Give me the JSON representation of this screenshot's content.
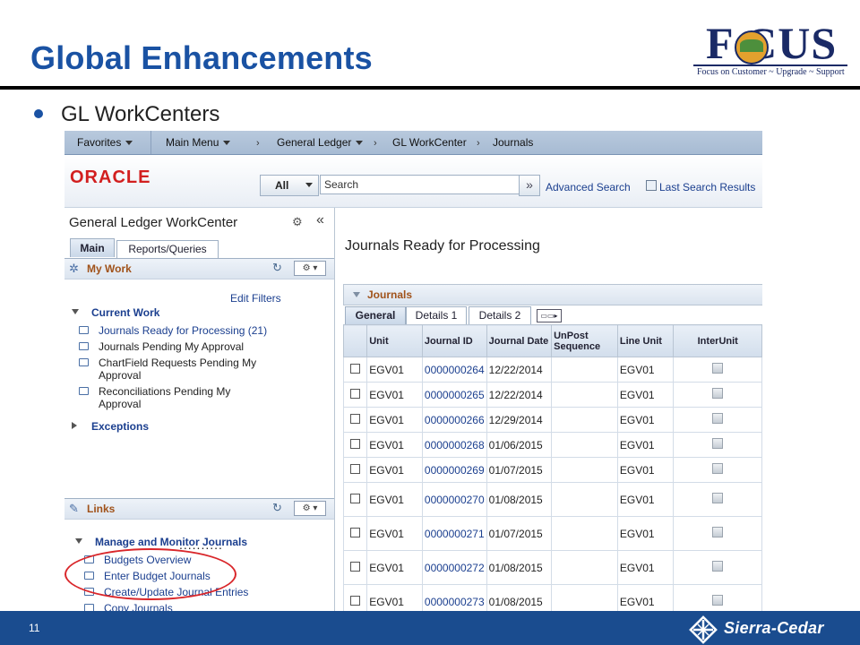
{
  "slide": {
    "title": "Global Enhancements",
    "bullet": "GL WorkCenters",
    "page_number": "11",
    "logo": {
      "word": "F  CUS",
      "tagline": "Focus on Customer ~ Upgrade ~ Support"
    },
    "footer_brand": "Sierra-Cedar",
    "colors": {
      "title": "#1a52a3",
      "footer": "#1a4c8f",
      "highlight_oval": "#d9262a"
    }
  },
  "app": {
    "navbar": {
      "favorites": "Favorites",
      "main_menu": "Main Menu",
      "crumbs": [
        "General Ledger",
        "GL WorkCenter",
        "Journals"
      ]
    },
    "header": {
      "brand": "ORACLE",
      "search_scope": "All",
      "search_placeholder": "Search",
      "advanced_search": "Advanced Search",
      "last_search_results": "Last Search Results"
    },
    "left_pane": {
      "title": "General Ledger WorkCenter",
      "tabs": [
        "Main",
        "Reports/Queries"
      ],
      "my_work": {
        "label": "My Work",
        "edit_filters": "Edit Filters",
        "current_work": "Current Work",
        "items": [
          "Journals Ready for Processing (21)",
          "Journals Pending My Approval",
          "ChartField Requests Pending My Approval",
          "Reconciliations Pending My Approval"
        ],
        "exceptions": "Exceptions",
        "more": ".........."
      },
      "links": {
        "label": "Links",
        "section": "Manage and Monitor Journals",
        "items": [
          "Budgets Overview",
          "Enter Budget Journals",
          "Create/Update Journal Entries",
          "Copy Journals"
        ]
      }
    },
    "main": {
      "page_title": "Journals Ready for Processing",
      "grid_title": "Journals",
      "tabs": [
        "General",
        "Details 1",
        "Details 2"
      ],
      "columns": [
        "Unit",
        "Journal ID",
        "Journal Date",
        "UnPost Sequence",
        "Line Unit",
        "InterUnit"
      ],
      "rows": [
        {
          "unit": "EGV01",
          "journal_id": "0000000264",
          "date": "12/22/2014",
          "seq": "",
          "line_unit": "EGV01"
        },
        {
          "unit": "EGV01",
          "journal_id": "0000000265",
          "date": "12/22/2014",
          "seq": "",
          "line_unit": "EGV01"
        },
        {
          "unit": "EGV01",
          "journal_id": "0000000266",
          "date": "12/29/2014",
          "seq": "",
          "line_unit": "EGV01"
        },
        {
          "unit": "EGV01",
          "journal_id": "0000000268",
          "date": "01/06/2015",
          "seq": "",
          "line_unit": "EGV01"
        },
        {
          "unit": "EGV01",
          "journal_id": "0000000269",
          "date": "01/07/2015",
          "seq": "",
          "line_unit": "EGV01"
        },
        {
          "unit": "EGV01",
          "journal_id": "0000000270",
          "date": "01/08/2015",
          "seq": "",
          "line_unit": "EGV01"
        },
        {
          "unit": "EGV01",
          "journal_id": "0000000271",
          "date": "01/07/2015",
          "seq": "",
          "line_unit": "EGV01"
        },
        {
          "unit": "EGV01",
          "journal_id": "0000000272",
          "date": "01/08/2015",
          "seq": "",
          "line_unit": "EGV01"
        },
        {
          "unit": "EGV01",
          "journal_id": "0000000273",
          "date": "01/08/2015",
          "seq": "",
          "line_unit": "EGV01"
        }
      ]
    }
  }
}
